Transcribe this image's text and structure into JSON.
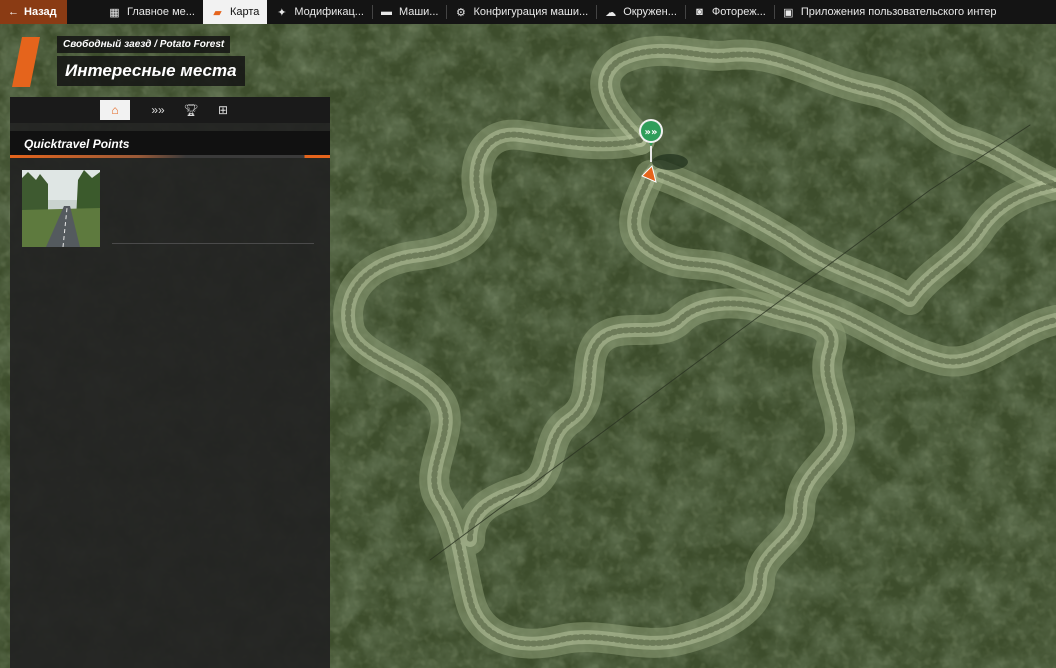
{
  "topbar": {
    "back_label": "Назад",
    "tabs": [
      {
        "label": "Главное ме...",
        "icon": "dashboard-icon",
        "active": false
      },
      {
        "label": "Карта",
        "icon": "map-icon",
        "active": true
      },
      {
        "label": "Модификац...",
        "icon": "puzzle-icon",
        "active": false
      },
      {
        "label": "Маши...",
        "icon": "car-icon",
        "active": false
      },
      {
        "label": "Конфигурация маши...",
        "icon": "engine-icon",
        "active": false
      },
      {
        "label": "Окружен...",
        "icon": "weather-icon",
        "active": false
      },
      {
        "label": "Фотореж...",
        "icon": "camera-icon",
        "active": false
      },
      {
        "label": "Приложения пользовательского интер",
        "icon": "apps-icon",
        "active": false
      }
    ]
  },
  "header": {
    "breadcrumb": "Свободный заезд / Potato Forest",
    "title": "Интересные места"
  },
  "panel": {
    "tabs": [
      {
        "icon": "location-icon",
        "active": true
      },
      {
        "icon": "chevrons-icon",
        "active": false
      },
      {
        "icon": "trophy-icon",
        "active": false
      },
      {
        "icon": "add-marker-icon",
        "active": false
      }
    ],
    "section_title": "Quicktravel Points",
    "items": [
      {
        "thumbnail": "forest-road-thumbnail"
      }
    ]
  },
  "map": {
    "markers": [
      {
        "icon": "quicktravel-marker-icon"
      },
      {
        "icon": "player-vehicle-icon"
      }
    ]
  },
  "colors": {
    "accent": "#e5641c",
    "back_button": "#8a3b14",
    "marker_green": "#2e9e5a",
    "panel_bg": "#222222"
  }
}
